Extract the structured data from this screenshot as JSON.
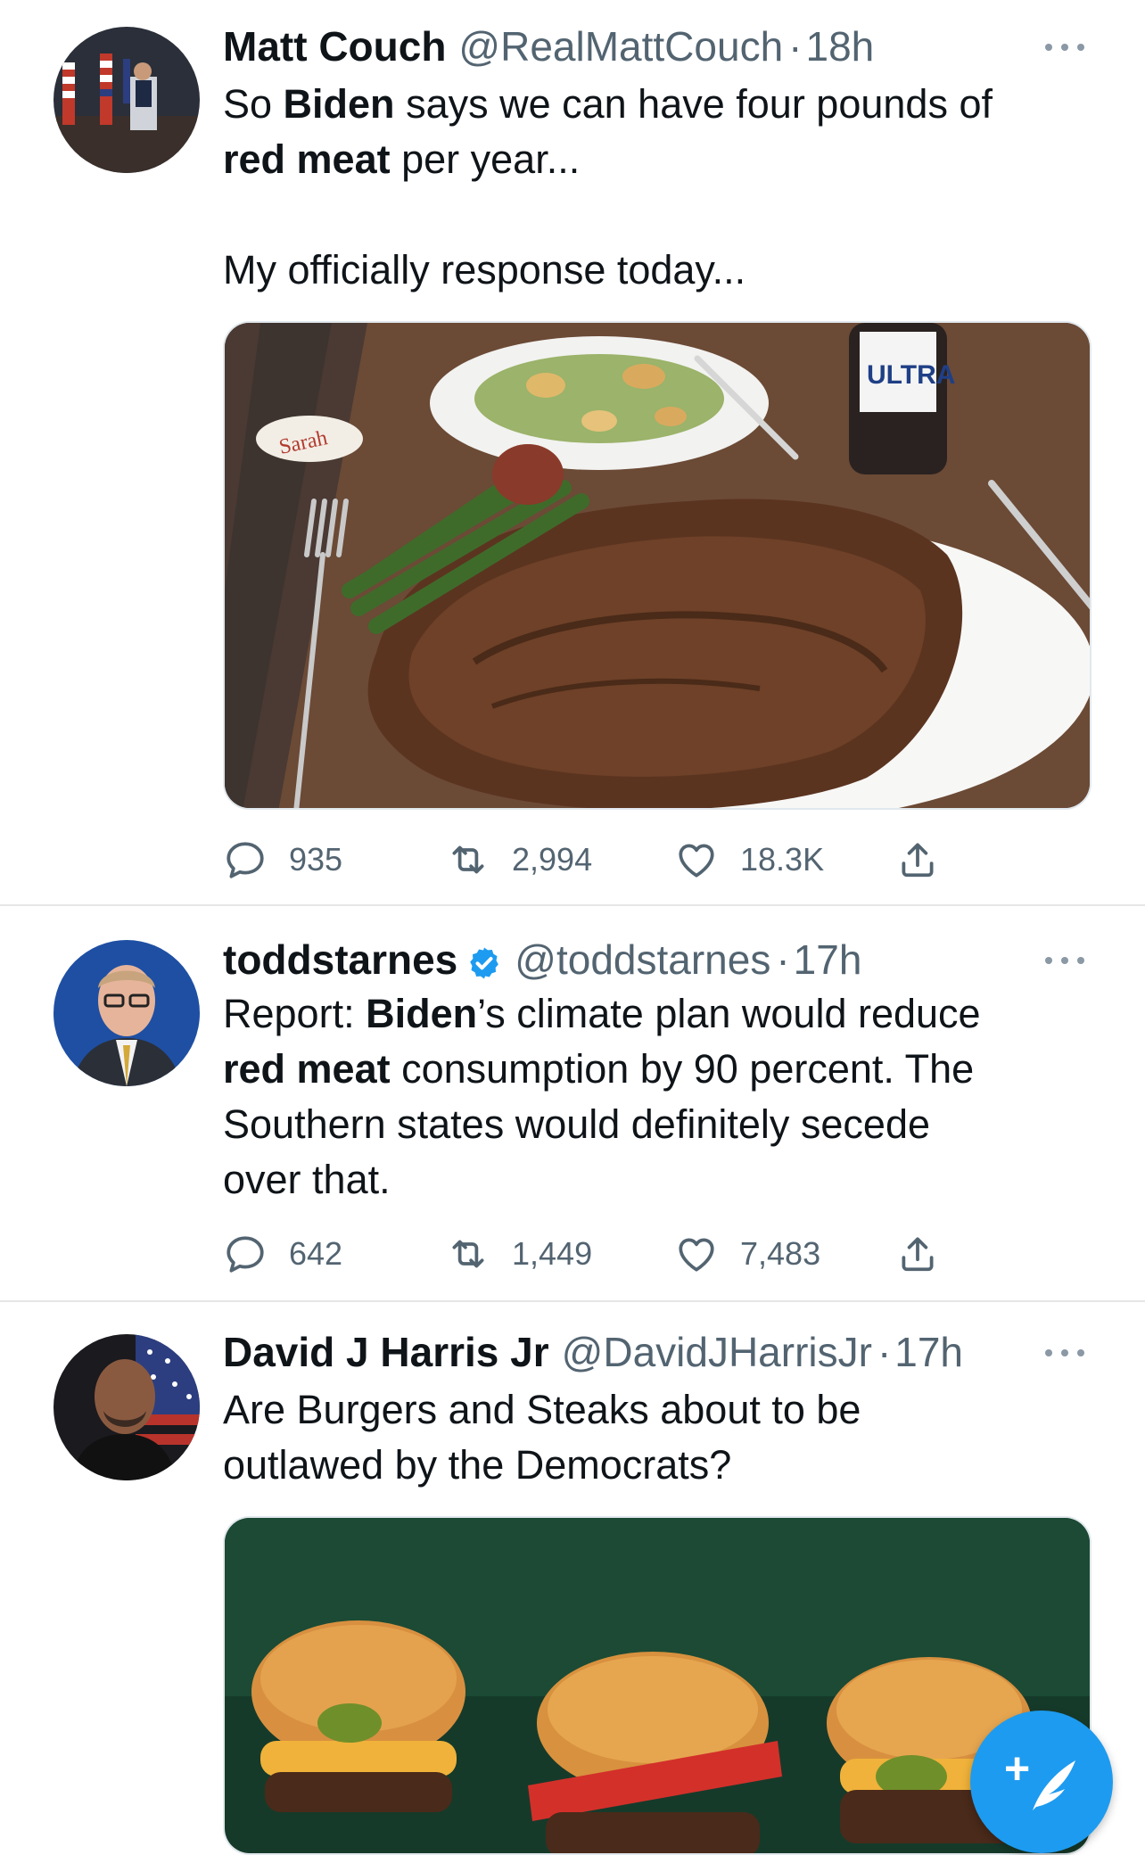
{
  "tweets": [
    {
      "name": "Matt Couch",
      "handle": "@RealMattCouch",
      "time": "18h",
      "text_line1": [
        "So ",
        "Biden",
        " says we can have four pounds of"
      ],
      "text_line2": [
        "red meat",
        " per year..."
      ],
      "text_line3": "My officially response today...",
      "image_desc": "steak dinner photo",
      "beer_label": "ULTRA",
      "badge_text": "Sarah",
      "replies": "935",
      "retweets": "2,994",
      "likes": "18.3K"
    },
    {
      "name": "toddstarnes",
      "handle": "@toddstarnes",
      "time": "17h",
      "verified": true,
      "line1": [
        "Report: ",
        "Biden",
        "’s climate plan would reduce"
      ],
      "line2": [
        "red meat",
        " consumption by 90 percent. The"
      ],
      "line3": "Southern states would definitely secede",
      "line4": "over that.",
      "replies": "642",
      "retweets": "1,449",
      "likes": "7,483"
    },
    {
      "name": "David J Harris Jr",
      "handle": "@DavidJHarrisJr",
      "time": "17h",
      "line1": "Are Burgers and Steaks about to be",
      "line2": "outlawed by the Democrats?",
      "image_desc": "burgers photo"
    }
  ],
  "separator": "·",
  "colors": {
    "accent": "#1d9bf0",
    "secondary_text": "#536471",
    "divider": "#e6e6e6"
  },
  "compose_button": {
    "icon": "compose-tweet-icon",
    "plus": "+"
  }
}
